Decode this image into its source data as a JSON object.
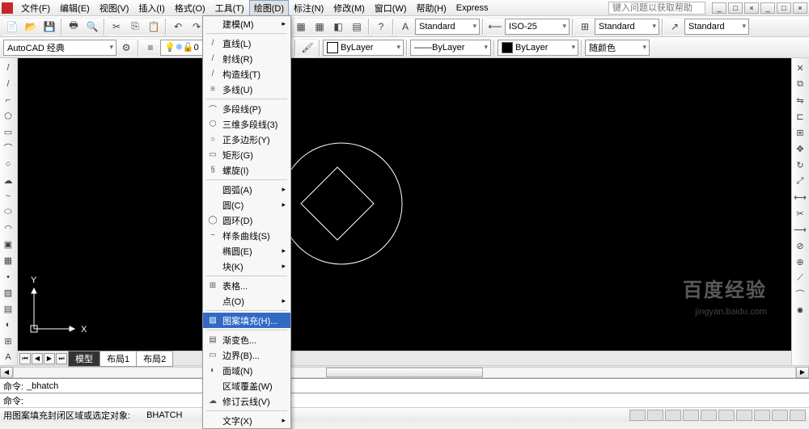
{
  "menubar": {
    "items": [
      "文件(F)",
      "编辑(E)",
      "视图(V)",
      "插入(I)",
      "格式(O)",
      "工具(T)",
      "绘图(D)",
      "标注(N)",
      "修改(M)",
      "窗口(W)",
      "帮助(H)",
      "Express"
    ],
    "active_index": 6,
    "help_placeholder": "键入问题以获取帮助"
  },
  "toolbar1": {
    "workspace_combo": "AutoCAD 经典",
    "style_combo1": "Standard",
    "style_combo2": "ISO-25",
    "style_combo3": "Standard",
    "style_combo4": "Standard"
  },
  "toolbar2": {
    "layer_combo": "0",
    "linetype_combo": "ByLayer",
    "lineweight_combo": "ByLayer",
    "color_combo": "ByLayer",
    "plotstyle_combo": "随颜色"
  },
  "dropdown": {
    "groups": [
      [
        {
          "icon": "",
          "label": "建模(M)",
          "sub": true
        }
      ],
      [
        {
          "icon": "/",
          "label": "直线(L)"
        },
        {
          "icon": "/",
          "label": "射线(R)"
        },
        {
          "icon": "/",
          "label": "构造线(T)"
        },
        {
          "icon": "≡",
          "label": "多线(U)"
        }
      ],
      [
        {
          "icon": "⌒",
          "label": "多段线(P)"
        },
        {
          "icon": "⬡",
          "label": "三维多段线(3)"
        },
        {
          "icon": "○",
          "label": "正多边形(Y)"
        },
        {
          "icon": "▭",
          "label": "矩形(G)"
        },
        {
          "icon": "§",
          "label": "螺旋(I)"
        }
      ],
      [
        {
          "icon": "",
          "label": "圆弧(A)",
          "sub": true
        },
        {
          "icon": "",
          "label": "圆(C)",
          "sub": true
        },
        {
          "icon": "◯",
          "label": "圆环(D)"
        },
        {
          "icon": "~",
          "label": "样条曲线(S)"
        },
        {
          "icon": "",
          "label": "椭圆(E)",
          "sub": true
        },
        {
          "icon": "",
          "label": "块(K)",
          "sub": true
        }
      ],
      [
        {
          "icon": "⊞",
          "label": "表格..."
        },
        {
          "icon": "",
          "label": "点(O)",
          "sub": true
        }
      ],
      [
        {
          "icon": "▨",
          "label": "图案填充(H)...",
          "hl": true
        }
      ],
      [
        {
          "icon": "▤",
          "label": "渐变色..."
        },
        {
          "icon": "▭",
          "label": "边界(B)..."
        },
        {
          "icon": "◐",
          "label": "面域(N)"
        },
        {
          "icon": "",
          "label": "区域覆盖(W)"
        },
        {
          "icon": "☁",
          "label": "修订云线(V)"
        }
      ],
      [
        {
          "icon": "",
          "label": "文字(X)",
          "sub": true
        }
      ]
    ]
  },
  "tabs": {
    "items": [
      "模型",
      "布局1",
      "布局2"
    ],
    "active_index": 0
  },
  "cmdline": {
    "prompt1": "命令:",
    "value1": "_bhatch",
    "prompt2": "命令:",
    "value2": ""
  },
  "statusbar": {
    "text": "用图案填充封闭区域或选定对象:",
    "cmd": "BHATCH"
  },
  "canvas": {
    "axis_x": "X",
    "axis_y": "Y"
  },
  "watermark": {
    "main": "百度经验",
    "sub": "jingyan.baidu.com"
  }
}
